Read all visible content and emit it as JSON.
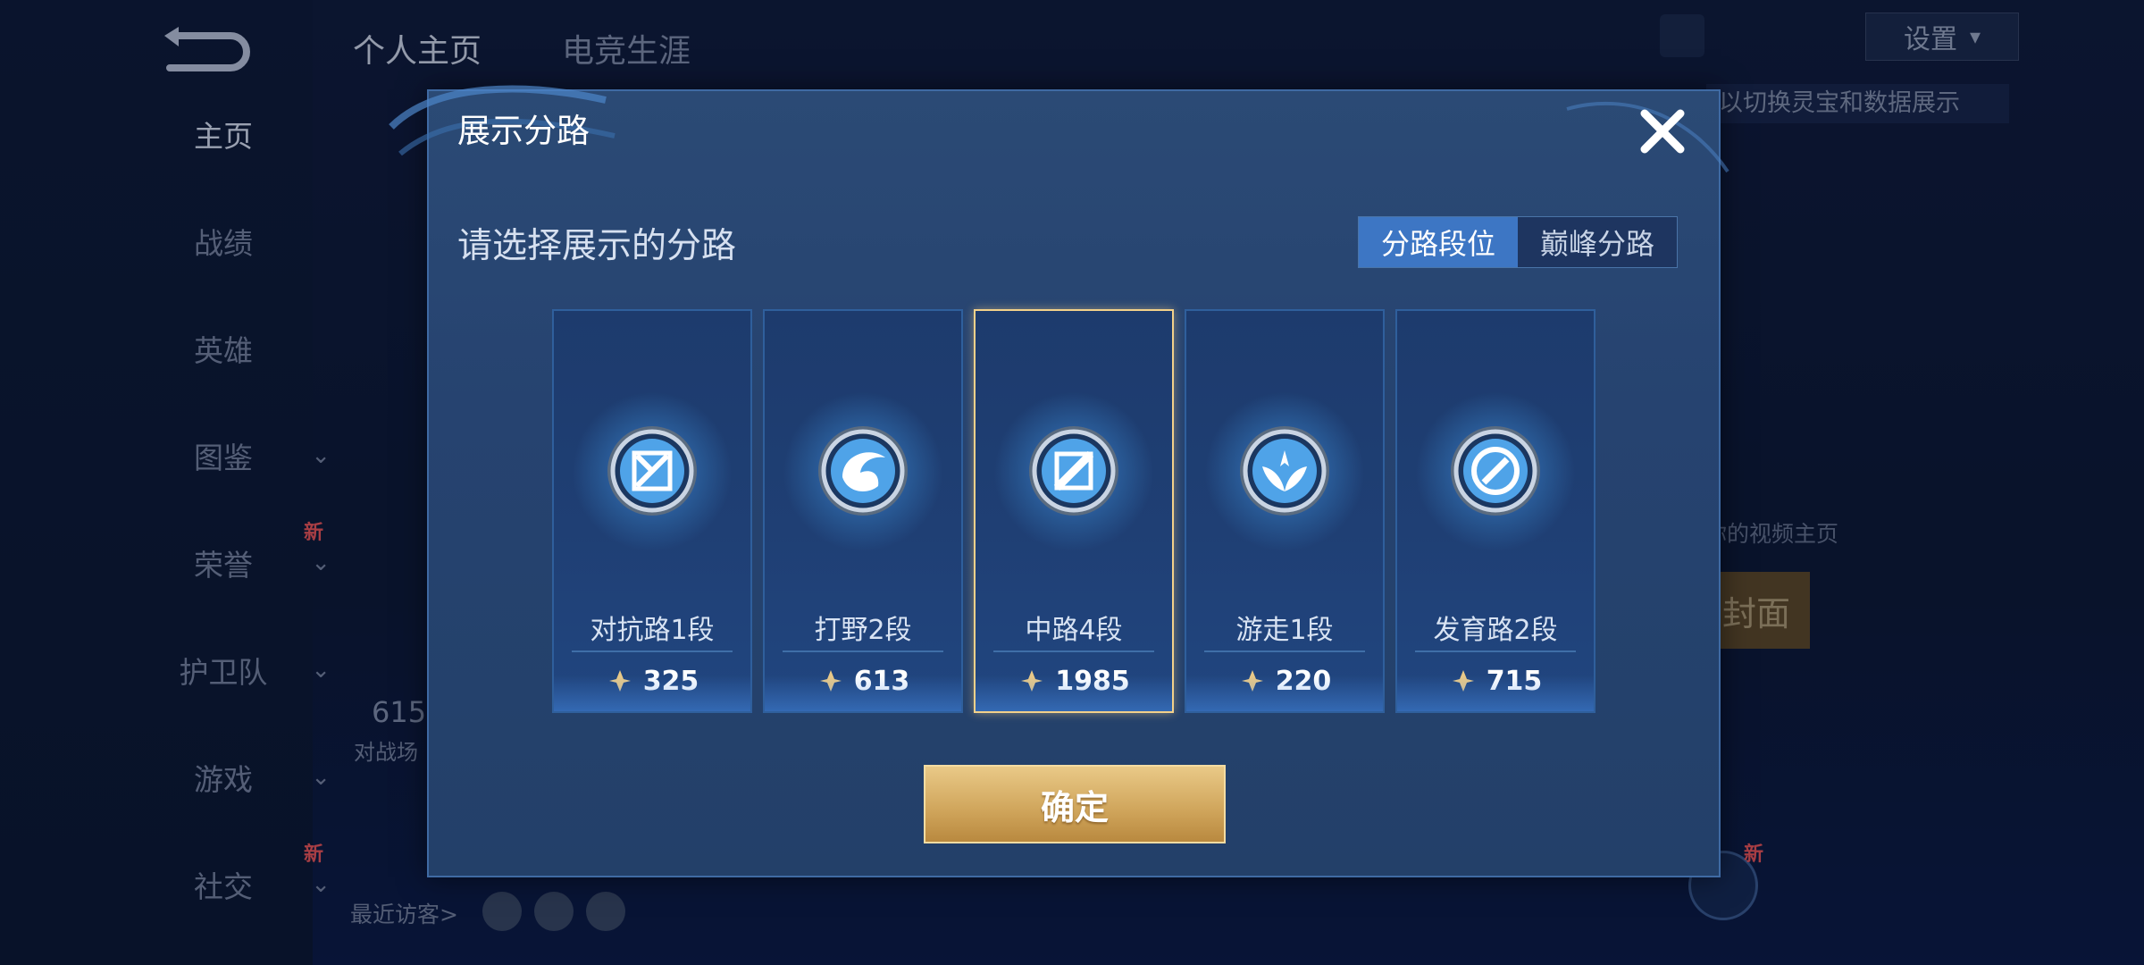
{
  "background": {
    "nav": [
      {
        "label": "主页",
        "active": true,
        "chevron": false,
        "new": false
      },
      {
        "label": "战绩",
        "active": false,
        "chevron": false,
        "new": false
      },
      {
        "label": "英雄",
        "active": false,
        "chevron": false,
        "new": false
      },
      {
        "label": "图鉴",
        "active": false,
        "chevron": true,
        "new": false
      },
      {
        "label": "荣誉",
        "active": false,
        "chevron": true,
        "new": true
      },
      {
        "label": "护卫队",
        "active": false,
        "chevron": true,
        "new": false
      },
      {
        "label": "游戏",
        "active": false,
        "chevron": true,
        "new": false
      },
      {
        "label": "社交",
        "active": false,
        "chevron": true,
        "new": true
      }
    ],
    "new_badge": "新",
    "top_tabs": [
      "个人主页",
      "电竞生涯"
    ],
    "settings_label": "设置",
    "hint_text": "以切换灵宝和数据展示",
    "stat_number": "615",
    "stat_label": "对战场",
    "recent_visitors": "最近访客>",
    "right_link_text": "你的视频主页",
    "right_button_text": "封面"
  },
  "dialog": {
    "title": "展示分路",
    "subtitle": "请选择展示的分路",
    "tabs": [
      {
        "label": "分路段位",
        "active": true
      },
      {
        "label": "巅峰分路",
        "active": false
      }
    ],
    "cards": [
      {
        "name": "对抗路1段",
        "points": "325",
        "emblem": "clash-lane-icon",
        "selected": false
      },
      {
        "name": "打野2段",
        "points": "613",
        "emblem": "jungle-dragon-icon",
        "selected": false
      },
      {
        "name": "中路4段",
        "points": "1985",
        "emblem": "mid-lane-icon",
        "selected": true
      },
      {
        "name": "游走1段",
        "points": "220",
        "emblem": "roam-wings-icon",
        "selected": false
      },
      {
        "name": "发育路2段",
        "points": "715",
        "emblem": "farm-lane-icon",
        "selected": false
      }
    ],
    "confirm_label": "确定"
  },
  "colors": {
    "accent_blue": "#3d76c4",
    "gold_button": "#cfa45a",
    "selected_border": "#f3d18a",
    "dialog_bg": "#264370"
  }
}
